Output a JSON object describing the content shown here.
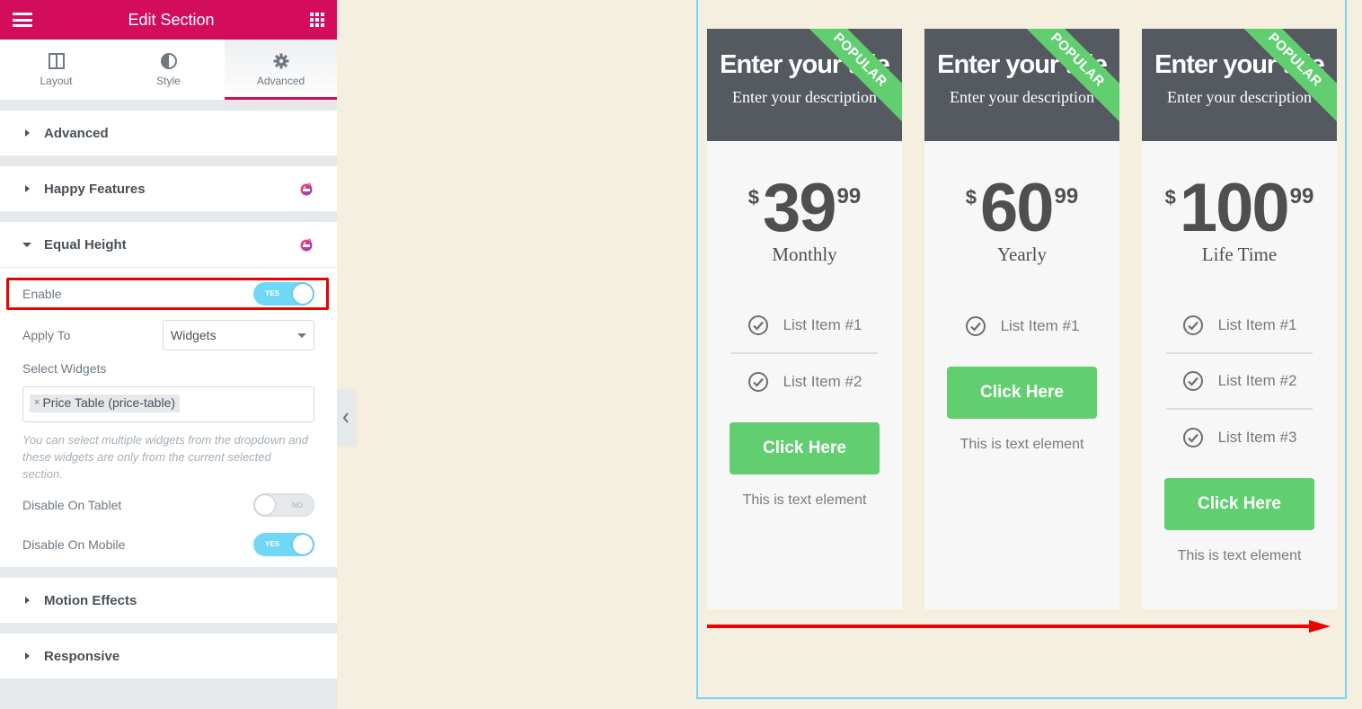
{
  "sidebar": {
    "header": {
      "title": "Edit Section",
      "menu_icon": "hamburger-icon",
      "apps_icon": "grid-icon"
    },
    "tabs": [
      {
        "label": "Layout",
        "icon": "columns-icon",
        "active": false
      },
      {
        "label": "Style",
        "icon": "contrast-icon",
        "active": false
      },
      {
        "label": "Advanced",
        "icon": "gear-icon",
        "active": true
      }
    ],
    "sections": {
      "advanced": {
        "title": "Advanced",
        "expanded": false
      },
      "happy_features": {
        "title": "Happy Features",
        "expanded": false,
        "badge_icon": "happy-addons-icon"
      },
      "equal_height": {
        "title": "Equal Height",
        "expanded": true,
        "badge_icon": "happy-addons-icon",
        "enable": {
          "label": "Enable",
          "value": "YES",
          "on": true
        },
        "apply_to": {
          "label": "Apply To",
          "value": "Widgets"
        },
        "select_widgets": {
          "label": "Select Widgets",
          "chips": [
            {
              "remove": "×",
              "label": "Price Table (price-table)"
            }
          ]
        },
        "help_text": "You can select multiple widgets from the dropdown and these widgets are only from the current selected section.",
        "disable_tablet": {
          "label": "Disable On Tablet",
          "value": "NO",
          "on": false
        },
        "disable_mobile": {
          "label": "Disable On Mobile",
          "value": "YES",
          "on": true
        }
      },
      "motion_effects": {
        "title": "Motion Effects",
        "expanded": false
      },
      "responsive": {
        "title": "Responsive",
        "expanded": false
      }
    }
  },
  "canvas": {
    "price_tables": [
      {
        "title": "Enter your title",
        "description": "Enter your description",
        "ribbon": "POPULAR",
        "currency": "$",
        "amount": "39",
        "fraction": "99",
        "period": "Monthly",
        "features": [
          "List Item #1",
          "List Item #2"
        ],
        "button": "Click Here",
        "text": "This is text element"
      },
      {
        "title": "Enter your title",
        "description": "Enter your description",
        "ribbon": "POPULAR",
        "currency": "$",
        "amount": "60",
        "fraction": "99",
        "period": "Yearly",
        "features": [
          "List Item #1"
        ],
        "button": "Click Here",
        "text": "This is text element"
      },
      {
        "title": "Enter your title",
        "description": "Enter your description",
        "ribbon": "POPULAR",
        "currency": "$",
        "amount": "100",
        "fraction": "99",
        "period": "Life Time",
        "features": [
          "List Item #1",
          "List Item #2",
          "List Item #3"
        ],
        "button": "Click Here",
        "text": "This is text element"
      }
    ]
  },
  "colors": {
    "brand": "#d30c5c",
    "toggle_on": "#71d7f7",
    "cta_green": "#61ce70",
    "card_header": "#555a61",
    "annotation_red": "#ee0000",
    "canvas_bg": "#f5efe0"
  }
}
